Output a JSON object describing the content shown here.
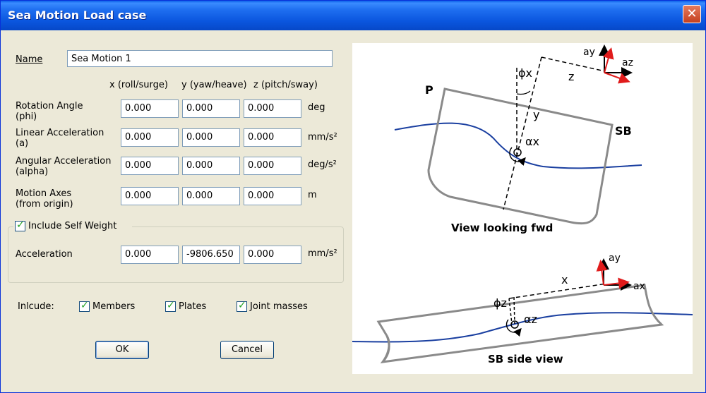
{
  "window": {
    "title": "Sea Motion Load case"
  },
  "icons": {
    "close": "close-icon",
    "check": "checkmark-icon"
  },
  "form": {
    "name_label": "Name",
    "name_value": "Sea Motion 1",
    "columns": [
      "x (roll/surge)",
      "y (yaw/heave)",
      "z (pitch/sway)"
    ],
    "rows": [
      {
        "label_line1": "Rotation Angle",
        "label_line2": "(phi)",
        "values": [
          "0.000",
          "0.000",
          "0.000"
        ],
        "unit": "deg"
      },
      {
        "label_line1": "Linear Acceleration",
        "label_line2": "(a)",
        "values": [
          "0.000",
          "0.000",
          "0.000"
        ],
        "unit": "mm/s²"
      },
      {
        "label_line1": "Angular Acceleration",
        "label_line2": "(alpha)",
        "values": [
          "0.000",
          "0.000",
          "0.000"
        ],
        "unit": "deg/s²"
      },
      {
        "label_line1": "Motion Axes",
        "label_line2": "(from origin)",
        "values": [
          "0.000",
          "0.000",
          "0.000"
        ],
        "unit": "m"
      }
    ],
    "self_weight": {
      "checkbox_label": "Include Self Weight",
      "checked": true,
      "acceleration_label": "Acceleration",
      "values": [
        "0.000",
        "-9806.650",
        "0.000"
      ],
      "unit": "mm/s²"
    },
    "include": {
      "label": "Inlcude:",
      "options": [
        {
          "label": "Members",
          "checked": true
        },
        {
          "label": "Plates",
          "checked": true
        },
        {
          "label": "Joint masses",
          "checked": true
        }
      ]
    },
    "buttons": {
      "ok": "OK",
      "cancel": "Cancel"
    }
  },
  "diagram": {
    "top": {
      "caption": "View looking fwd",
      "label_port": "P",
      "label_starboard": "SB",
      "label_phi": "ϕx",
      "label_alpha": "αx",
      "label_z": "z",
      "label_y": "y",
      "axis_ay": "ay",
      "axis_az": "az"
    },
    "bottom": {
      "caption": "SB side view",
      "label_phi": "ϕz",
      "label_alpha": "αz",
      "label_x": "x",
      "axis_ay": "ay",
      "axis_ax": "ax"
    },
    "colors": {
      "hull": "#8a8a8a",
      "wave": "#1a3fa0",
      "axis_black": "#000000",
      "axis_red": "#e01b1b"
    }
  }
}
